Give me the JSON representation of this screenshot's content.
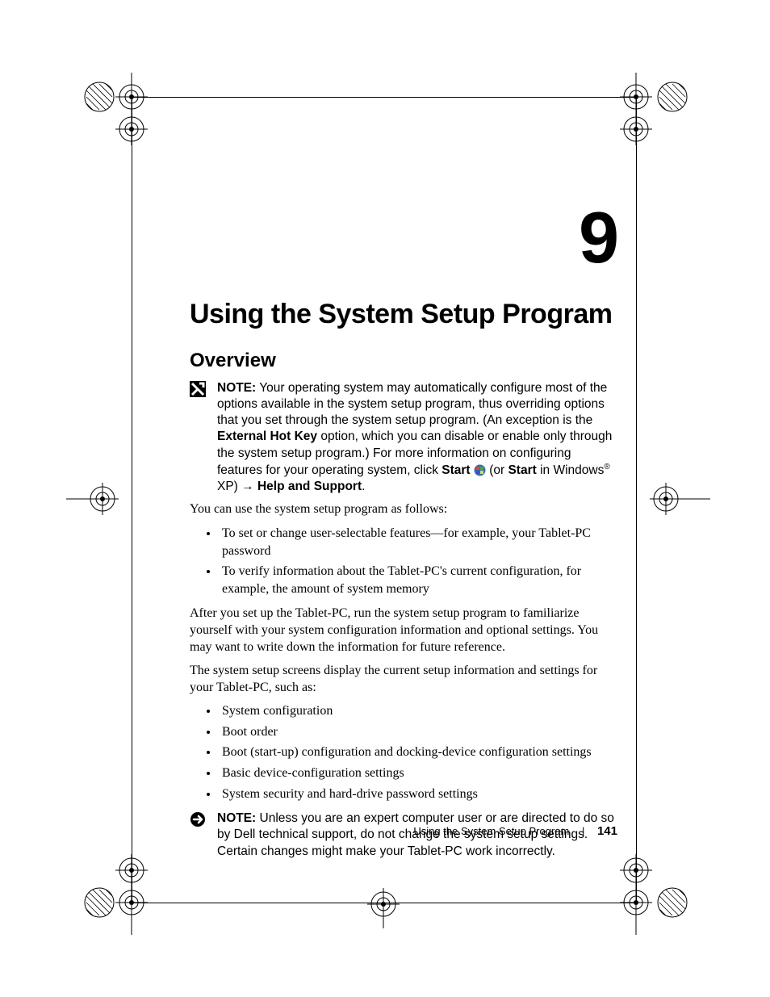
{
  "chapter": {
    "number": "9",
    "title": "Using the System Setup Program"
  },
  "section": {
    "overview_title": "Overview"
  },
  "note1": {
    "label": "NOTE:",
    "t1": " Your operating system may automatically configure most of the options available in the system setup program, thus overriding options that you set through the system setup program. (An exception is the ",
    "b1": "External Hot Key",
    "t2": " option, which you can disable or enable only through the system setup program.) For more information on configuring features for your operating system, click ",
    "b2": "Start",
    "t3": " ",
    "t4": " (or ",
    "b3": "Start",
    "t5": " in Windows",
    "sup": "®",
    "t6": " XP) → ",
    "b4": "Help and Support",
    "t7": "."
  },
  "body": {
    "p1": "You can use the system setup program as follows:",
    "list1": [
      "To set or change user-selectable features—for example, your Tablet-PC password",
      "To verify information about the Tablet-PC's current configuration, for example, the amount of system memory"
    ],
    "p2": "After you set up the Tablet-PC, run the system setup program to familiarize yourself with your system configuration information and optional settings. You may want to write down the information for future reference.",
    "p3": "The system setup screens display the current setup information and settings for your Tablet-PC, such as:",
    "list2": [
      "System configuration",
      "Boot order",
      "Boot (start-up) configuration and docking-device configuration settings",
      "Basic device-configuration settings",
      "System security and hard-drive password settings"
    ]
  },
  "note2": {
    "label": "NOTE:",
    "text": " Unless you are an expert computer user or are directed to do so by Dell technical support, do not change the system setup settings. Certain changes might make your Tablet-PC work incorrectly."
  },
  "footer": {
    "section": "Using the System Setup Program",
    "sep": "|",
    "page": "141"
  }
}
